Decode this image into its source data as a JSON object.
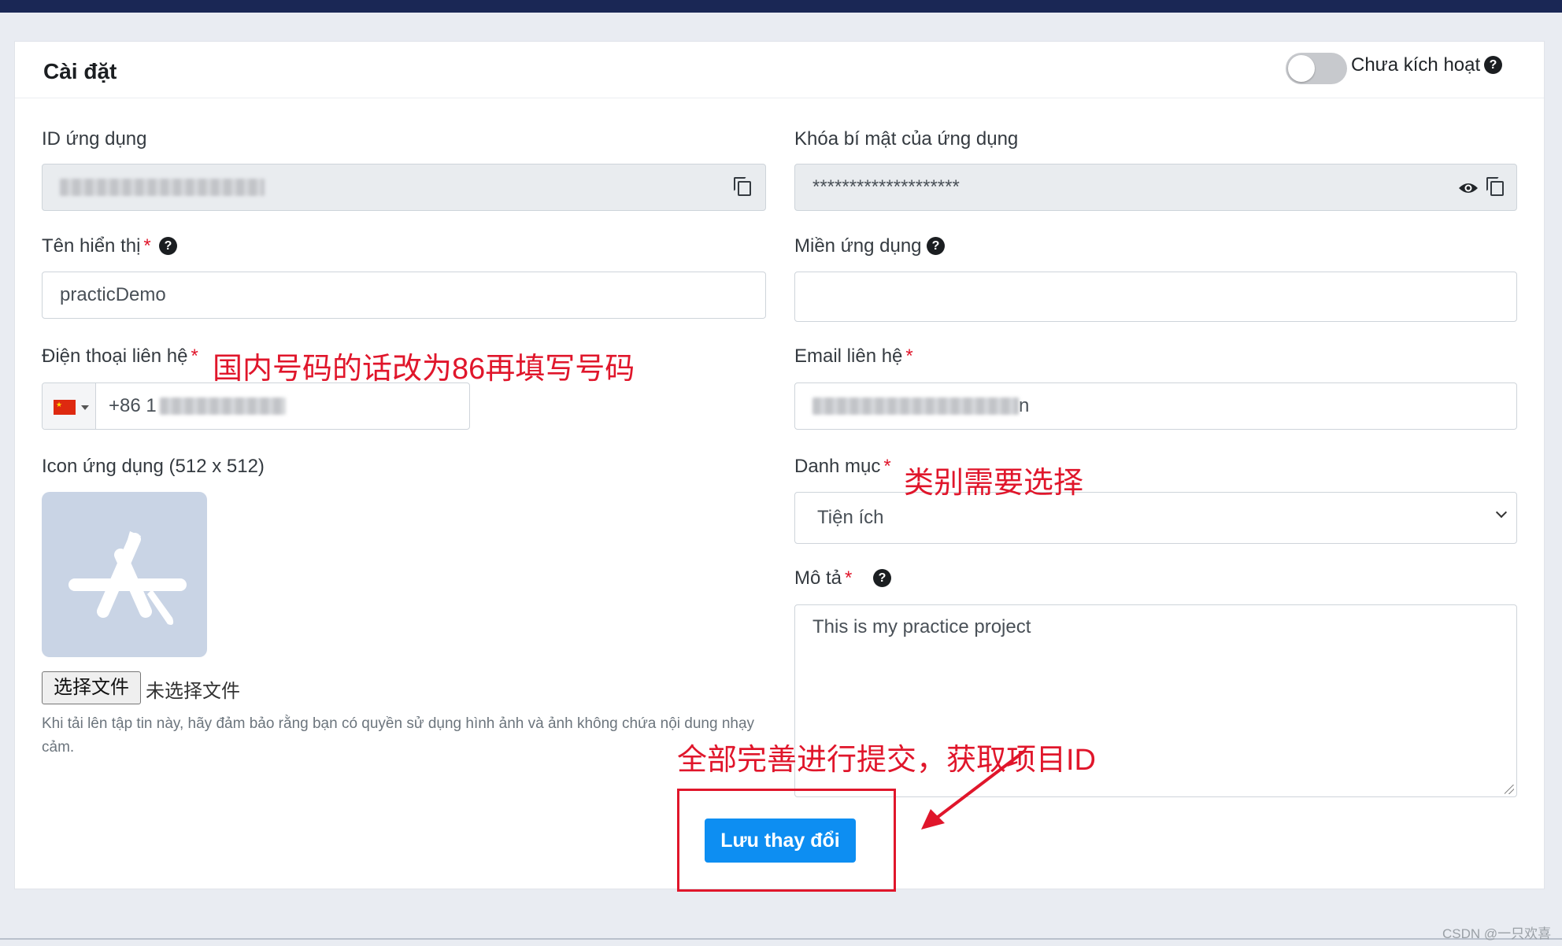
{
  "settings": {
    "title": "Cài đặt",
    "activation_status": "Chưa kích hoạt"
  },
  "fields": {
    "app_id_label": "ID ứng dụng",
    "app_secret_label": "Khóa bí mật của ứng dụng",
    "app_secret_value": "********************",
    "display_name_label": "Tên hiển thị",
    "display_name_value": "practicDemo",
    "domain_label": "Miền ứng dụng",
    "domain_value": "",
    "phone_label": "Điện thoại liên hệ",
    "phone_prefix": "+86 1",
    "email_label": "Email liên hệ",
    "email_suffix": "n",
    "icon_label": "Icon ứng dụng (512 x 512)",
    "category_label": "Danh mục",
    "category_value": "Tiện ích",
    "description_label": "Mô tả",
    "description_value": "This is my practice project",
    "required_mark": "*",
    "help_mark": "?"
  },
  "file_input": {
    "button_label": "选择文件",
    "status": "未选择文件",
    "hint": "Khi tải lên tập tin này, hãy đảm bảo rằng bạn có quyền sử dụng hình ảnh và ảnh không chứa nội dung nhạy cảm."
  },
  "actions": {
    "save_label": "Lưu thay đổi"
  },
  "annotations": {
    "phone_note": "国内号码的话改为86再填写号码",
    "category_note": "类别需要选择",
    "submit_note": "全部完善进行提交，获取项目ID"
  },
  "watermark": "CSDN @一只欢喜",
  "colors": {
    "topbar": "#1a2755",
    "primary_button": "#0d8ef2",
    "annotation_red": "#e0162b",
    "required_red": "#e0162b"
  }
}
